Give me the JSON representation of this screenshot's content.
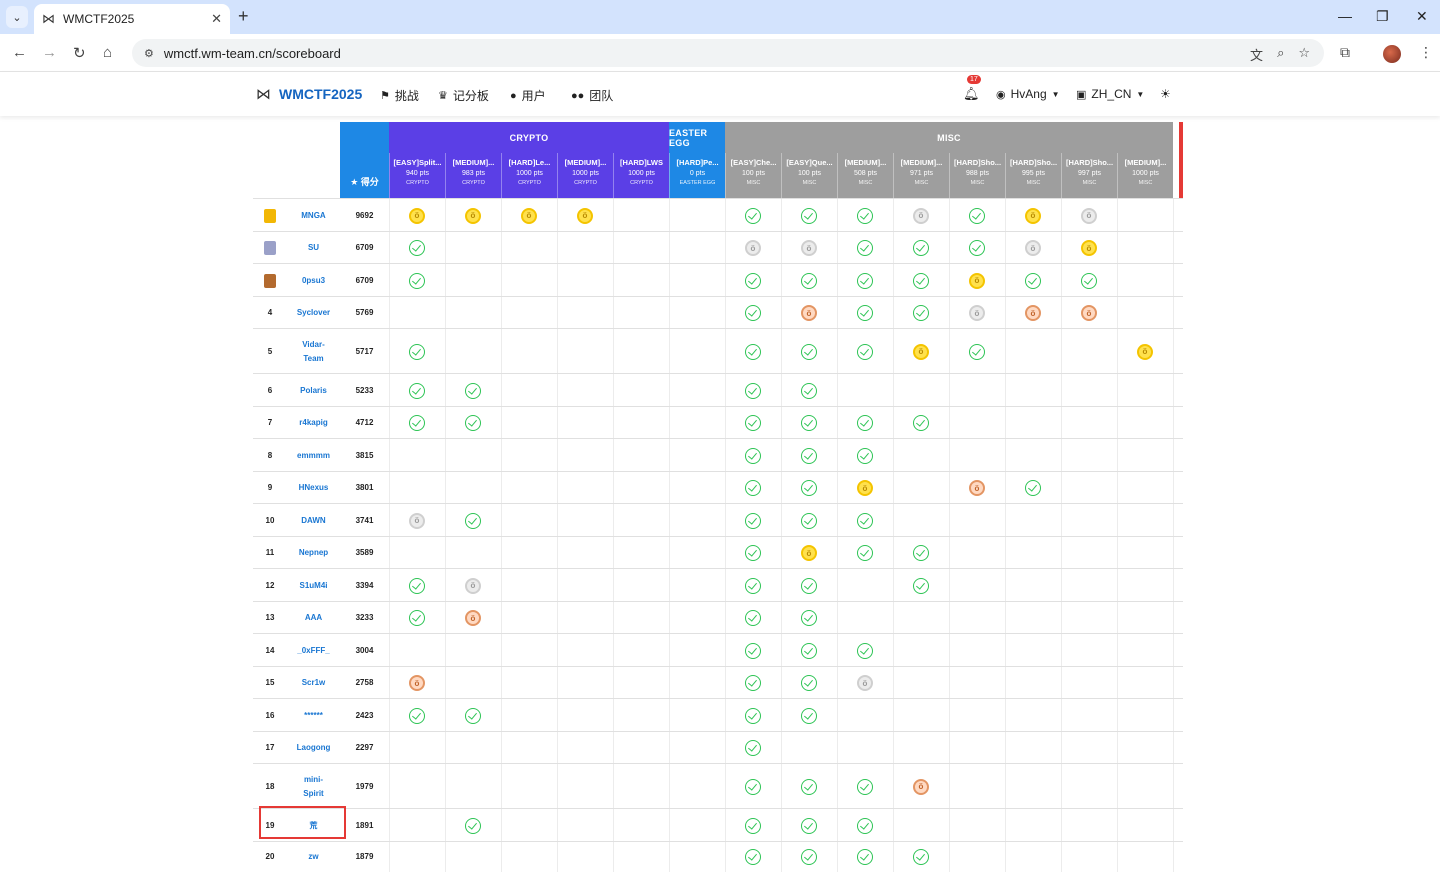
{
  "browser": {
    "tab_title": "WMCTF2025",
    "url": "wmctf.wm-team.cn/scoreboard"
  },
  "site": {
    "brand": "WMCTF2025",
    "nav": [
      {
        "label": "挑战",
        "icon": "flag-icon"
      },
      {
        "label": "记分板",
        "icon": "trophy-icon"
      },
      {
        "label": "用户",
        "icon": "user-icon"
      },
      {
        "label": "团队",
        "icon": "users-icon"
      }
    ],
    "notification_count": "17",
    "username": "HvAng",
    "language": "ZH_CN"
  },
  "scoreboard": {
    "score_header": "得分",
    "categories": [
      {
        "name": "CRYPTO",
        "color": "#5b3fe6"
      },
      {
        "name": "EASTER EGG",
        "color": "#1e88e5"
      },
      {
        "name": "MISC",
        "color": "#9e9e9e"
      }
    ],
    "challenges": [
      {
        "name": "[EASY]Split...",
        "pts": "940 pts",
        "cat": "CRYPTO"
      },
      {
        "name": "[MEDIUM]...",
        "pts": "983 pts",
        "cat": "CRYPTO"
      },
      {
        "name": "[HARD]Le...",
        "pts": "1000 pts",
        "cat": "CRYPTO"
      },
      {
        "name": "[MEDIUM]...",
        "pts": "1000 pts",
        "cat": "CRYPTO"
      },
      {
        "name": "[HARD]LWS",
        "pts": "1000 pts",
        "cat": "CRYPTO"
      },
      {
        "name": "[HARD]Pe...",
        "pts": "0 pts",
        "cat": "EASTER EGG"
      },
      {
        "name": "[EASY]Che...",
        "pts": "100 pts",
        "cat": "MISC"
      },
      {
        "name": "[EASY]Que...",
        "pts": "100 pts",
        "cat": "MISC"
      },
      {
        "name": "[MEDIUM]...",
        "pts": "508 pts",
        "cat": "MISC"
      },
      {
        "name": "[MEDIUM]...",
        "pts": "971 pts",
        "cat": "MISC"
      },
      {
        "name": "[HARD]Sho...",
        "pts": "988 pts",
        "cat": "MISC"
      },
      {
        "name": "[HARD]Sho...",
        "pts": "995 pts",
        "cat": "MISC"
      },
      {
        "name": "[HARD]Sho...",
        "pts": "997 pts",
        "cat": "MISC"
      },
      {
        "name": "[MEDIUM]...",
        "pts": "1000 pts",
        "cat": "MISC"
      }
    ],
    "rows": [
      {
        "rank": "",
        "rank_icon": "gold",
        "team": "MNGA",
        "score": "9692",
        "marks": [
          "g",
          "g",
          "g",
          "g",
          "",
          "",
          "s",
          "s",
          "s",
          "sv",
          "s",
          "g",
          "sv",
          ""
        ]
      },
      {
        "rank": "",
        "rank_icon": "silver",
        "team": "SU",
        "score": "6709",
        "marks": [
          "s",
          "",
          "",
          "",
          "",
          "",
          "sv",
          "sv",
          "s",
          "s",
          "s",
          "sv",
          "g",
          ""
        ]
      },
      {
        "rank": "",
        "rank_icon": "bronze",
        "team": "0psu3",
        "score": "6709",
        "marks": [
          "s",
          "",
          "",
          "",
          "",
          "",
          "s",
          "s",
          "s",
          "s",
          "g",
          "s",
          "s",
          ""
        ]
      },
      {
        "rank": "4",
        "team": "Syclover",
        "score": "5769",
        "marks": [
          "",
          "",
          "",
          "",
          "",
          "",
          "s",
          "b",
          "s",
          "s",
          "sv",
          "b",
          "b",
          ""
        ]
      },
      {
        "rank": "5",
        "team": "Vidar-\nTeam",
        "score": "5717",
        "marks": [
          "s",
          "",
          "",
          "",
          "",
          "",
          "s",
          "s",
          "s",
          "g",
          "s",
          "",
          "",
          "g"
        ]
      },
      {
        "rank": "6",
        "team": "Polaris",
        "score": "5233",
        "marks": [
          "s",
          "s",
          "",
          "",
          "",
          "",
          "s",
          "s",
          "",
          "",
          "",
          "",
          "",
          ""
        ]
      },
      {
        "rank": "7",
        "team": "r4kapig",
        "score": "4712",
        "marks": [
          "s",
          "s",
          "",
          "",
          "",
          "",
          "s",
          "s",
          "s",
          "s",
          "",
          "",
          "",
          ""
        ]
      },
      {
        "rank": "8",
        "team": "emmmm",
        "score": "3815",
        "marks": [
          "",
          "",
          "",
          "",
          "",
          "",
          "s",
          "s",
          "s",
          "",
          "",
          "",
          "",
          ""
        ]
      },
      {
        "rank": "9",
        "team": "HNexus",
        "score": "3801",
        "marks": [
          "",
          "",
          "",
          "",
          "",
          "",
          "s",
          "s",
          "g",
          "",
          "b",
          "s",
          "",
          ""
        ]
      },
      {
        "rank": "10",
        "team": "DAWN",
        "score": "3741",
        "marks": [
          "sv",
          "s",
          "",
          "",
          "",
          "",
          "s",
          "s",
          "s",
          "",
          "",
          "",
          "",
          ""
        ]
      },
      {
        "rank": "11",
        "team": "Nepnep",
        "score": "3589",
        "marks": [
          "",
          "",
          "",
          "",
          "",
          "",
          "s",
          "g",
          "s",
          "s",
          "",
          "",
          "",
          ""
        ]
      },
      {
        "rank": "12",
        "team": "S1uM4i",
        "score": "3394",
        "marks": [
          "s",
          "sv",
          "",
          "",
          "",
          "",
          "s",
          "s",
          "",
          "s",
          "",
          "",
          "",
          ""
        ]
      },
      {
        "rank": "13",
        "team": "AAA",
        "score": "3233",
        "marks": [
          "s",
          "b",
          "",
          "",
          "",
          "",
          "s",
          "s",
          "",
          "",
          "",
          "",
          "",
          ""
        ]
      },
      {
        "rank": "14",
        "team": "_0xFFF_",
        "score": "3004",
        "marks": [
          "",
          "",
          "",
          "",
          "",
          "",
          "s",
          "s",
          "s",
          "",
          "",
          "",
          "",
          ""
        ]
      },
      {
        "rank": "15",
        "team": "Scr1w",
        "score": "2758",
        "marks": [
          "b",
          "",
          "",
          "",
          "",
          "",
          "s",
          "s",
          "sv",
          "",
          "",
          "",
          "",
          ""
        ]
      },
      {
        "rank": "16",
        "team": "******",
        "score": "2423",
        "marks": [
          "s",
          "s",
          "",
          "",
          "",
          "",
          "s",
          "s",
          "",
          "",
          "",
          "",
          "",
          ""
        ]
      },
      {
        "rank": "17",
        "team": "Laogong",
        "score": "2297",
        "marks": [
          "",
          "",
          "",
          "",
          "",
          "",
          "s",
          "",
          "",
          "",
          "",
          "",
          "",
          ""
        ]
      },
      {
        "rank": "18",
        "team": "mini-\nSpirit",
        "score": "1979",
        "marks": [
          "",
          "",
          "",
          "",
          "",
          "",
          "s",
          "s",
          "s",
          "b",
          "",
          "",
          "",
          ""
        ]
      },
      {
        "rank": "19",
        "team": "荒",
        "score": "1891",
        "marks": [
          "",
          "s",
          "",
          "",
          "",
          "",
          "s",
          "s",
          "s",
          "",
          "",
          "",
          "",
          ""
        ]
      },
      {
        "rank": "20",
        "team": "zw",
        "score": "1879",
        "marks": [
          "",
          "",
          "",
          "",
          "",
          "",
          "s",
          "s",
          "s",
          "s",
          "",
          "",
          "",
          ""
        ]
      }
    ]
  }
}
